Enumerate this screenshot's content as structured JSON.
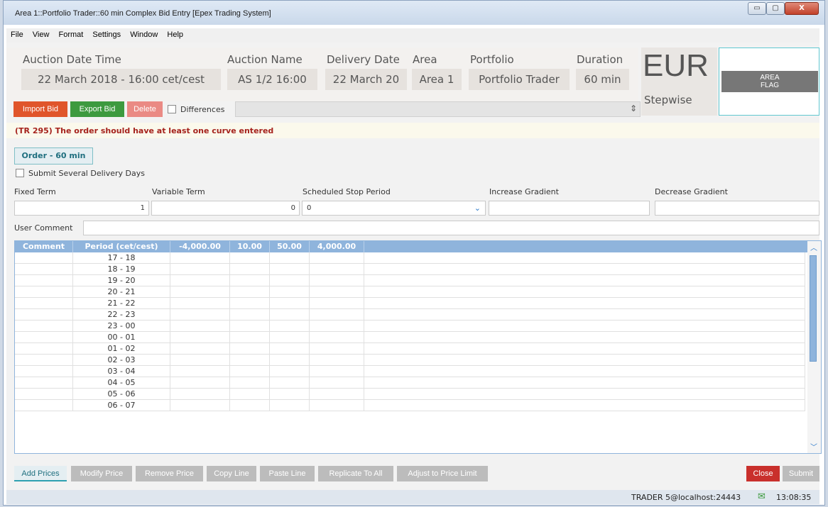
{
  "window": {
    "title": "Area 1::Portfolio Trader::60 min Complex Bid Entry [Epex Trading System]",
    "min": "▭",
    "max": "▢",
    "close": "X"
  },
  "menu": [
    "File",
    "View",
    "Format",
    "Settings",
    "Window",
    "Help"
  ],
  "header": {
    "auction_datetime_label": "Auction Date Time",
    "auction_datetime": "22 March 2018 - 16:00 cet/cest",
    "auction_name_label": "Auction Name",
    "auction_name": "AS 1/2 16:00",
    "delivery_date_label": "Delivery Date",
    "delivery_date": "22 March 20",
    "area_label": "Area",
    "area": "Area 1",
    "portfolio_label": "Portfolio",
    "portfolio": "Portfolio Trader",
    "duration_label": "Duration",
    "duration": "60 min",
    "currency": "EUR",
    "mode": "Stepwise",
    "flag_line1": "AREA",
    "flag_line2": "FLAG"
  },
  "toolbar": {
    "import": "Import Bid",
    "export": "Export Bid",
    "delete": "Delete",
    "differences": "Differences"
  },
  "error": "(TR 295) The order should have at least one curve entered",
  "order_button": "Order - 60 min",
  "several_days": "Submit Several Delivery Days",
  "terms": {
    "fixed_label": "Fixed Term",
    "fixed": "1",
    "variable_label": "Variable Term",
    "variable": "0",
    "stop_label": "Scheduled Stop Period",
    "stop": "0",
    "increase_label": "Increase Gradient",
    "decrease_label": "Decrease Gradient"
  },
  "user_comment_label": "User Comment",
  "grid": {
    "headers": [
      "Comment",
      "Period (cet/cest)",
      "-4,000.00",
      "10.00",
      "50.00",
      "4,000.00"
    ],
    "periods": [
      "17 - 18",
      "18 - 19",
      "19 - 20",
      "20 - 21",
      "21 - 22",
      "22 - 23",
      "23 - 00",
      "00 - 01",
      "01 - 02",
      "02 - 03",
      "03 - 04",
      "04 - 05",
      "05 - 06",
      "06 - 07"
    ]
  },
  "bottom": {
    "add": "Add Prices",
    "modify": "Modify Price",
    "remove": "Remove Price",
    "copy": "Copy Line",
    "paste": "Paste Line",
    "replicate": "Replicate To All",
    "adjust": "Adjust to Price Limit",
    "close": "Close",
    "submit": "Submit"
  },
  "status": {
    "user": "TRADER 5@localhost:24443",
    "time": "13:08:35"
  },
  "colors": {
    "import": "#e0552b",
    "export": "#3d9a3f",
    "delete": "#ea8a84",
    "close": "#c9302c",
    "grid_header": "#8fb4dc"
  }
}
